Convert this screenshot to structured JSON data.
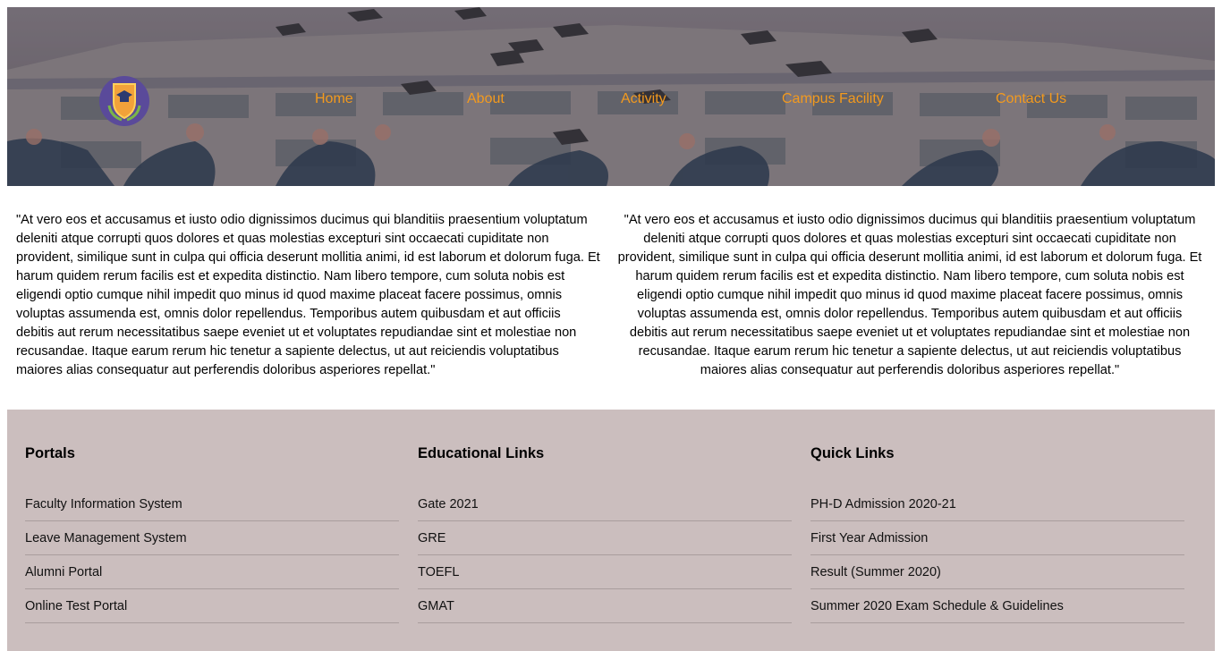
{
  "nav": {
    "items": [
      "Home",
      "About",
      "Activity",
      "Campus Facility",
      "Contact Us"
    ]
  },
  "content": {
    "left_paragraph": "\"At vero eos et accusamus et iusto odio dignissimos ducimus qui blanditiis praesentium voluptatum deleniti atque corrupti quos dolores et quas molestias excepturi sint occaecati cupiditate non provident, similique sunt in culpa qui officia deserunt mollitia animi, id est laborum et dolorum fuga. Et harum quidem rerum facilis est et expedita distinctio. Nam libero tempore, cum soluta nobis est eligendi optio cumque nihil impedit quo minus id quod maxime placeat facere possimus, omnis voluptas assumenda est, omnis dolor repellendus. Temporibus autem quibusdam et aut officiis debitis aut rerum necessitatibus saepe eveniet ut et voluptates repudiandae sint et molestiae non recusandae. Itaque earum rerum hic tenetur a sapiente delectus, ut aut reiciendis voluptatibus maiores alias consequatur aut perferendis doloribus asperiores repellat.\"",
    "right_paragraph": "\"At vero eos et accusamus et iusto odio dignissimos ducimus qui blanditiis praesentium voluptatum deleniti atque corrupti quos dolores et quas molestias excepturi sint occaecati cupiditate non provident, similique sunt in culpa qui officia deserunt mollitia animi, id est laborum et dolorum fuga. Et harum quidem rerum facilis est et expedita distinctio. Nam libero tempore, cum soluta nobis est eligendi optio cumque nihil impedit quo minus id quod maxime placeat facere possimus, omnis voluptas assumenda est, omnis dolor repellendus. Temporibus autem quibusdam et aut officiis debitis aut rerum necessitatibus saepe eveniet ut et voluptates repudiandae sint et molestiae non recusandae. Itaque earum rerum hic tenetur a sapiente delectus, ut aut reiciendis voluptatibus maiores alias consequatur aut perferendis doloribus asperiores repellat.\""
  },
  "footer": {
    "columns": [
      {
        "title": "Portals",
        "links": [
          "Faculty Information System",
          "Leave Management System",
          "Alumni Portal",
          "Online Test Portal"
        ]
      },
      {
        "title": "Educational Links",
        "links": [
          "Gate 2021",
          "GRE",
          "TOEFL",
          "GMAT"
        ]
      },
      {
        "title": "Quick Links",
        "links": [
          "PH-D Admission 2020-21",
          "First Year Admission",
          "Result (Summer 2020)",
          "Summer 2020 Exam Schedule & Guidelines"
        ]
      }
    ]
  },
  "colors": {
    "nav_link": "#f39a1e",
    "footer_bg": "#cbbebe",
    "divider": "#a99d9d"
  },
  "icons": {
    "logo": "graduation-cap-shield-logo"
  }
}
